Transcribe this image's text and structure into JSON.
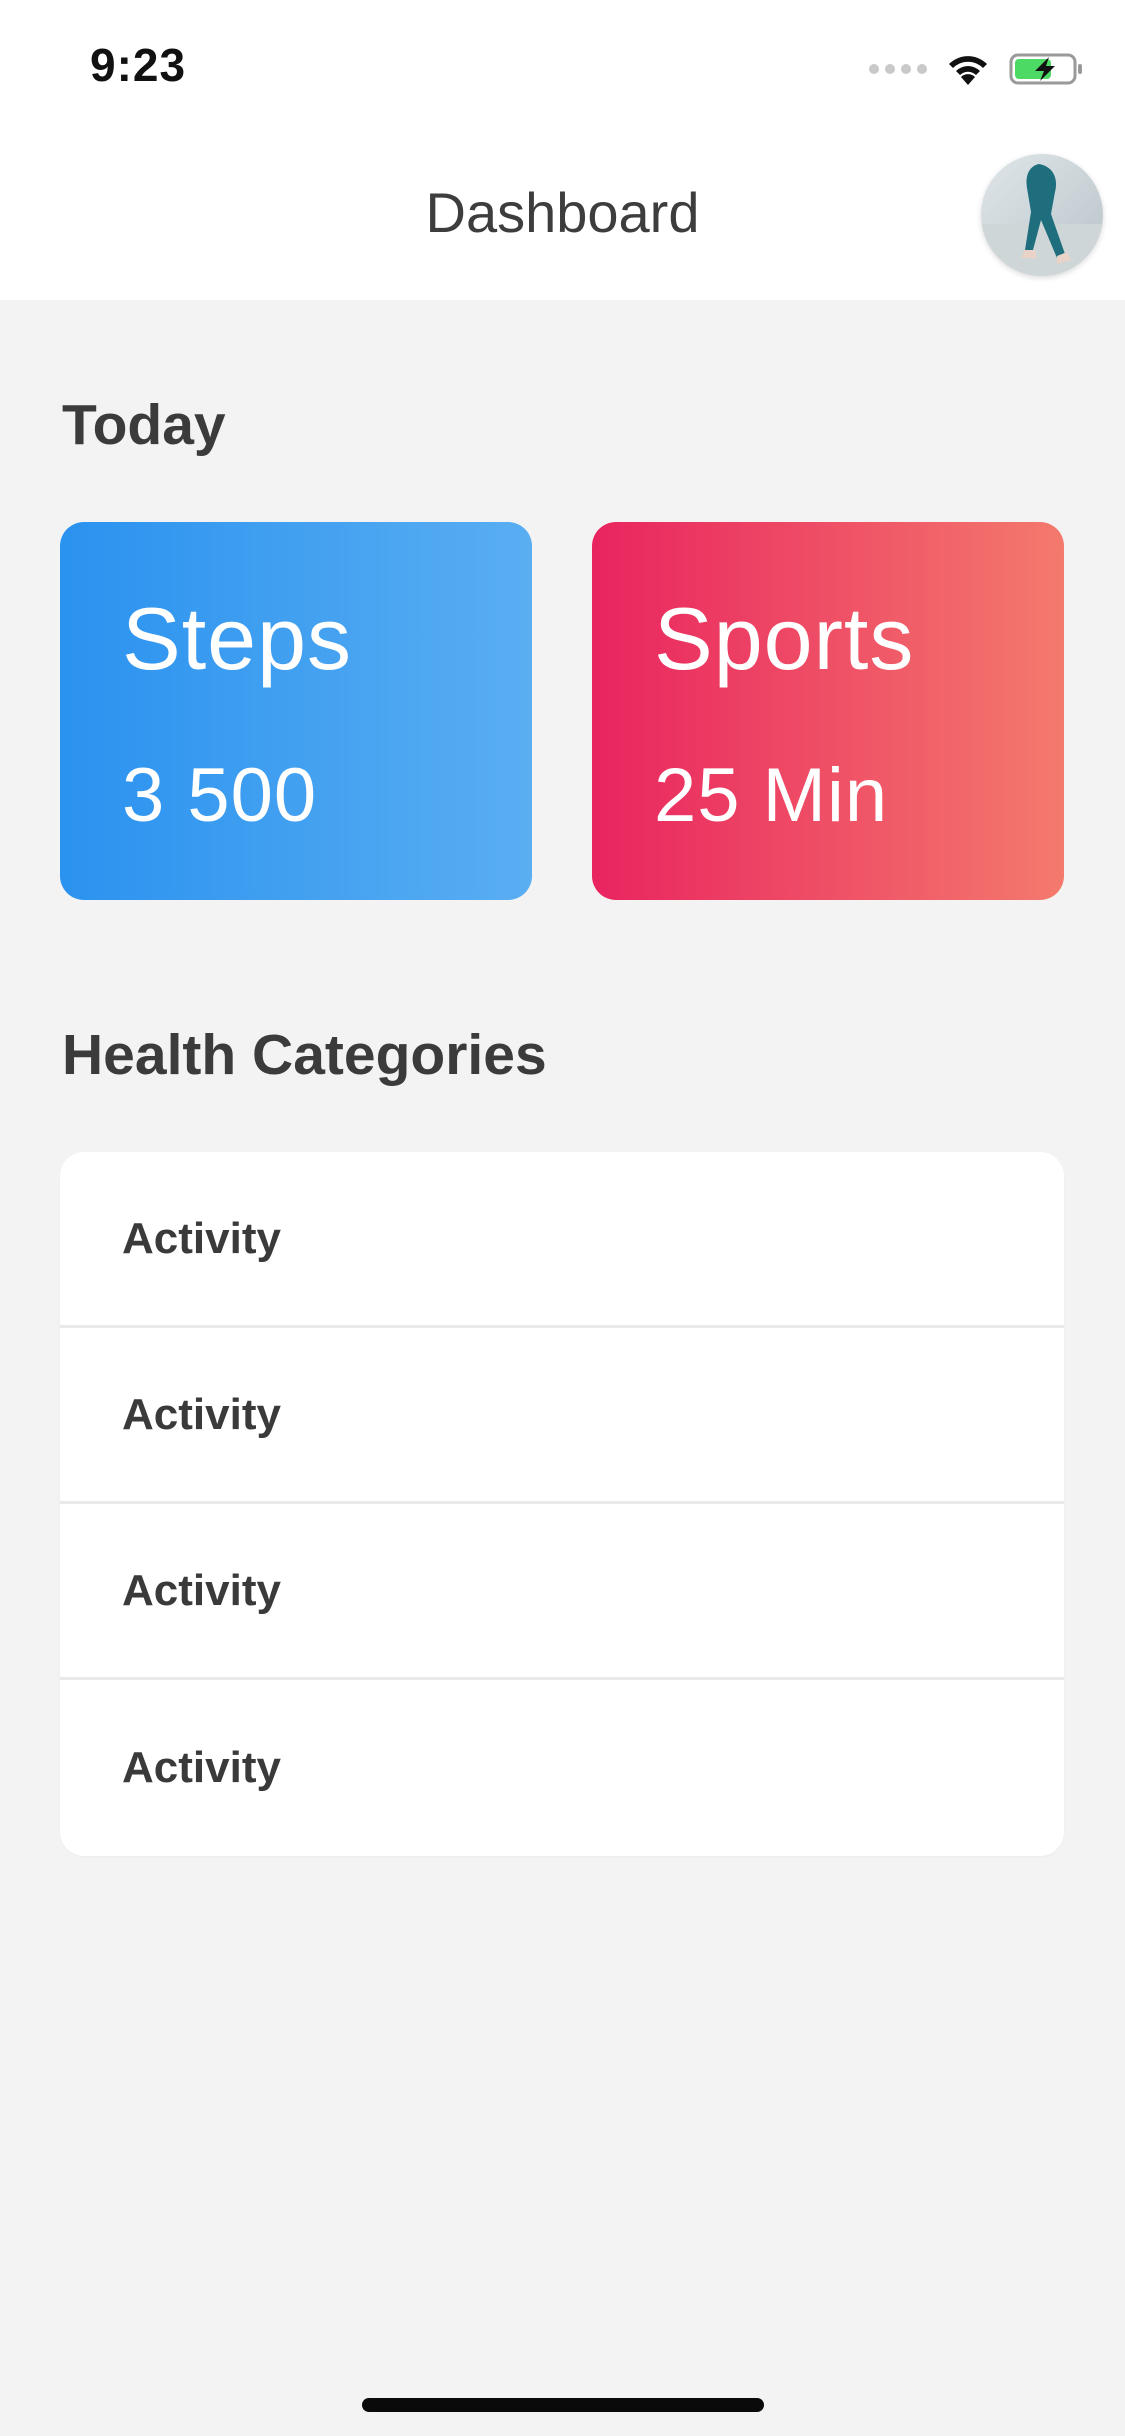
{
  "status_bar": {
    "time": "9:23",
    "icons": [
      "signal-icon",
      "wifi-icon",
      "battery-charging-icon"
    ],
    "battery_color": "#4cd964"
  },
  "header": {
    "title": "Dashboard",
    "avatar": "user-avatar-icon"
  },
  "today": {
    "title": "Today",
    "cards": [
      {
        "label": "Steps",
        "value": "3 500",
        "gradient": [
          "#2a92ef",
          "#5aaef2"
        ]
      },
      {
        "label": "Sports",
        "value": "25 Min",
        "gradient": [
          "#e9245f",
          "#f47a6d"
        ]
      }
    ]
  },
  "health_categories": {
    "title": "Health Categories",
    "items": [
      {
        "label": "Activity"
      },
      {
        "label": "Activity"
      },
      {
        "label": "Activity"
      },
      {
        "label": "Activity"
      }
    ]
  },
  "colors": {
    "background": "#f3f3f3",
    "surface": "#ffffff",
    "text": "#3c3c3c"
  }
}
